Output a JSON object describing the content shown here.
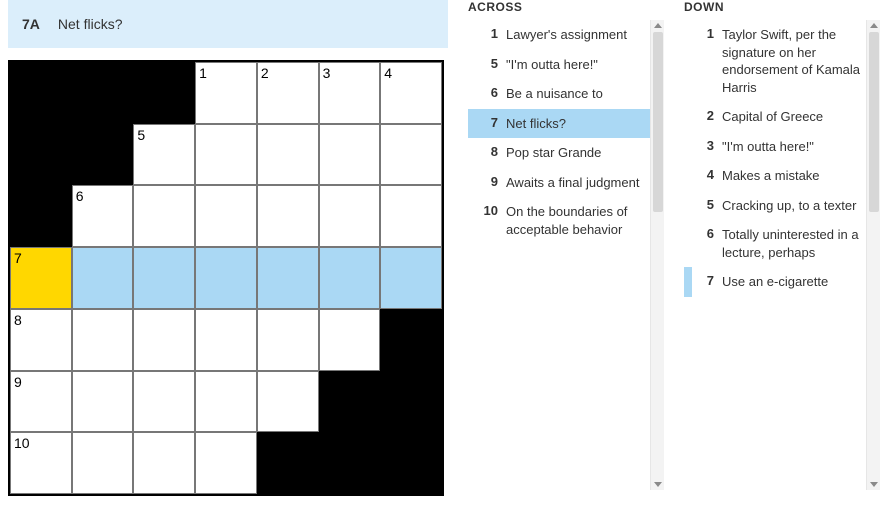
{
  "current_clue": {
    "label": "7A",
    "text": "Net flicks?"
  },
  "grid": {
    "rows": 7,
    "cols": 7,
    "cells": [
      [
        {
          "black": true
        },
        {
          "black": true
        },
        {
          "black": true
        },
        {
          "num": "1"
        },
        {
          "num": "2"
        },
        {
          "num": "3"
        },
        {
          "num": "4"
        }
      ],
      [
        {
          "black": true
        },
        {
          "black": true
        },
        {
          "num": "5"
        },
        {},
        {},
        {},
        {}
      ],
      [
        {
          "black": true
        },
        {
          "num": "6"
        },
        {},
        {},
        {},
        {},
        {}
      ],
      [
        {
          "num": "7",
          "cursor": true
        },
        {
          "hl": true
        },
        {
          "hl": true
        },
        {
          "hl": true
        },
        {
          "hl": true
        },
        {
          "hl": true
        },
        {
          "hl": true
        }
      ],
      [
        {
          "num": "8"
        },
        {},
        {},
        {},
        {},
        {},
        {
          "black": true
        }
      ],
      [
        {
          "num": "9"
        },
        {},
        {},
        {},
        {},
        {
          "black": true
        },
        {
          "black": true
        }
      ],
      [
        {
          "num": "10"
        },
        {},
        {},
        {},
        {
          "black": true
        },
        {
          "black": true
        },
        {
          "black": true
        }
      ]
    ]
  },
  "across": {
    "heading": "ACROSS",
    "clues": [
      {
        "num": "1",
        "text": "Lawyer's assignment"
      },
      {
        "num": "5",
        "text": "\"I'm outta here!\""
      },
      {
        "num": "6",
        "text": "Be a nuisance to"
      },
      {
        "num": "7",
        "text": "Net flicks?",
        "selected": "primary"
      },
      {
        "num": "8",
        "text": "Pop star Grande"
      },
      {
        "num": "9",
        "text": "Awaits a final judgment"
      },
      {
        "num": "10",
        "text": "On the boundaries of acceptable behavior"
      }
    ]
  },
  "down": {
    "heading": "DOWN",
    "clues": [
      {
        "num": "1",
        "text": "Taylor Swift, per the signature on her endorsement of Kamala Harris"
      },
      {
        "num": "2",
        "text": "Capital of Greece"
      },
      {
        "num": "3",
        "text": "\"I'm outta here!\""
      },
      {
        "num": "4",
        "text": "Makes a mistake"
      },
      {
        "num": "5",
        "text": "Cracking up, to a texter"
      },
      {
        "num": "6",
        "text": "Totally uninterested in a lecture, perhaps"
      },
      {
        "num": "7",
        "text": "Use an e-cigarette",
        "selected": "secondary"
      }
    ]
  }
}
